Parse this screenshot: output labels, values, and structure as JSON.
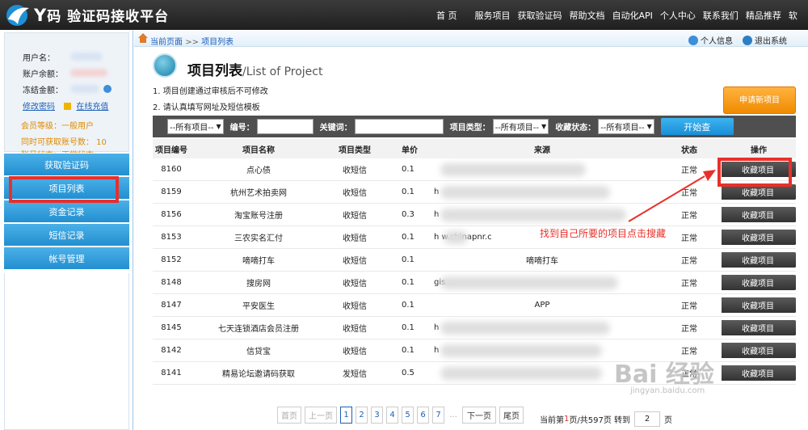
{
  "header": {
    "logo_y": "Y",
    "logo_text_a": "码",
    "logo_text_b": "验证码接收平台",
    "nav": [
      "首 页",
      "服务项目",
      "获取验证码",
      "帮助文档",
      "自动化API",
      "个人中心",
      "联系我们",
      "精品推荐",
      "软"
    ]
  },
  "user": {
    "username_label": "用户名：",
    "balance_label": "账户余额：",
    "frozen_label": "冻结金额：",
    "change_password": "修改密码",
    "recharge": "在线充值",
    "level": "会员等级：一般用户",
    "max_accounts": "同时可获取账号数：  10",
    "status": "账号状态：正常状态"
  },
  "sidebar": {
    "items": [
      "获取验证码",
      "项目列表",
      "资金记录",
      "短信记录",
      "帐号管理"
    ]
  },
  "breadcrumb": {
    "current": "当前页面",
    "sep": ">>",
    "page": "项目列表",
    "personal_info": "个人信息",
    "logout": "退出系统"
  },
  "title": {
    "main": "项目列表",
    "sub": "/List of Project"
  },
  "notes": [
    "1. 项目创建通过审核后不可修改",
    "2. 请认真填写网址及短信模板"
  ],
  "apply_button": "申请新项目",
  "filter": {
    "all_projects": "--所有项目--",
    "code_label": "编号：",
    "keyword_label": "关键词：",
    "type_label": "项目类型：",
    "type_value": "--所有项目--",
    "fav_label": "收藏状态：",
    "fav_value": "--所有项目--",
    "search": "开始查"
  },
  "table": {
    "headers": [
      "项目编号",
      "项目名称",
      "项目类型",
      "单价",
      "来源",
      "状态",
      "操作"
    ],
    "action_label": "收藏项目",
    "rows": [
      {
        "id": "8160",
        "name": "点心债",
        "type": "收短信",
        "price": "0.1",
        "source": "",
        "status": "正常"
      },
      {
        "id": "8159",
        "name": "杭州艺术拍卖网",
        "type": "收短信",
        "price": "0.1",
        "source": "h",
        "status": "正常"
      },
      {
        "id": "8156",
        "name": "淘宝账号注册",
        "type": "收短信",
        "price": "0.3",
        "source": "h",
        "status": "正常"
      },
      {
        "id": "8153",
        "name": "三农实名汇付",
        "type": "收短信",
        "price": "0.1",
        "source": "h      w.chinapnr.c",
        "status": "正常"
      },
      {
        "id": "8152",
        "name": "嘀嘀打车",
        "type": "收短信",
        "price": "0.1",
        "source": "嘀嘀打车",
        "status": "正常"
      },
      {
        "id": "8148",
        "name": "搜房网",
        "type": "收短信",
        "price": "0.1",
        "source": "            gis...",
        "status": "正常"
      },
      {
        "id": "8147",
        "name": "平安医生",
        "type": "收短信",
        "price": "0.1",
        "source": "APP",
        "status": "正常"
      },
      {
        "id": "8145",
        "name": "七天连锁酒店会员注册",
        "type": "收短信",
        "price": "0.1",
        "source": "h",
        "status": "正常"
      },
      {
        "id": "8142",
        "name": "信贷宝",
        "type": "收短信",
        "price": "0.1",
        "source": "h",
        "status": "正常"
      },
      {
        "id": "8141",
        "name": "精易论坛邀请码获取",
        "type": "发短信",
        "price": "0.5",
        "source": "",
        "status": "正常"
      }
    ]
  },
  "pager": {
    "first": "首页",
    "prev": "上一页",
    "pages": [
      "1",
      "2",
      "3",
      "4",
      "5",
      "6",
      "7"
    ],
    "ellipsis": "...",
    "next": "下一页",
    "last": "尾页",
    "info_a": "当前第",
    "current_page": "1",
    "info_b": "页/共597页 转到",
    "goto_value": "2",
    "info_c": "页"
  },
  "annotation": {
    "text": "找到自己所要的项目点击搜藏",
    "color": "#e8302a"
  },
  "watermark": {
    "main": "Bai 经验",
    "sub": "jingyan.baidu.com"
  }
}
